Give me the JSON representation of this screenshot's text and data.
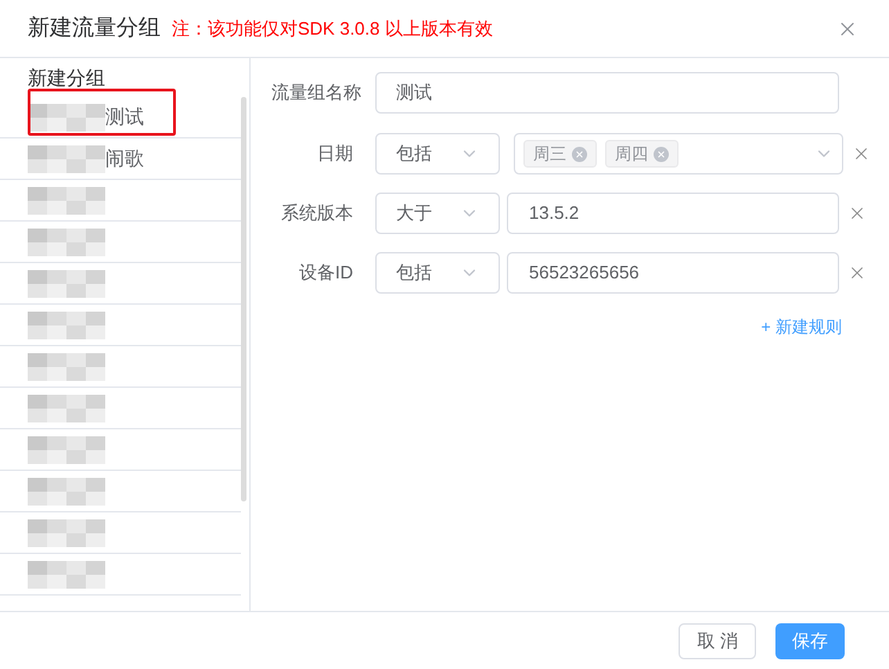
{
  "dialog": {
    "title": "新建流量分组",
    "note": "注：该功能仅对SDK 3.0.8 以上版本有效"
  },
  "sidebar": {
    "header": "新建分组",
    "items": [
      {
        "text": "测试",
        "highlighted": true
      },
      {
        "text": "闹歌",
        "highlighted": false
      },
      {
        "highlighted": false
      },
      {
        "highlighted": false
      },
      {
        "highlighted": false
      },
      {
        "highlighted": false
      },
      {
        "highlighted": false
      },
      {
        "highlighted": false
      },
      {
        "highlighted": false
      },
      {
        "highlighted": false
      },
      {
        "highlighted": false
      },
      {
        "highlighted": false
      }
    ]
  },
  "form": {
    "name_label": "流量组名称",
    "name_value": "测试",
    "rules": [
      {
        "kind": "tags",
        "label": "日期",
        "operator": "包括",
        "tags": [
          "周三",
          "周四"
        ]
      },
      {
        "kind": "text",
        "label": "系统版本",
        "operator": "大于",
        "value": "13.5.2"
      },
      {
        "kind": "text",
        "label": "设备ID",
        "operator": "包括",
        "value": "56523265656"
      }
    ],
    "add_rule": "+ 新建规则"
  },
  "buttons": {
    "cancel": "取 消",
    "save": "保存"
  }
}
